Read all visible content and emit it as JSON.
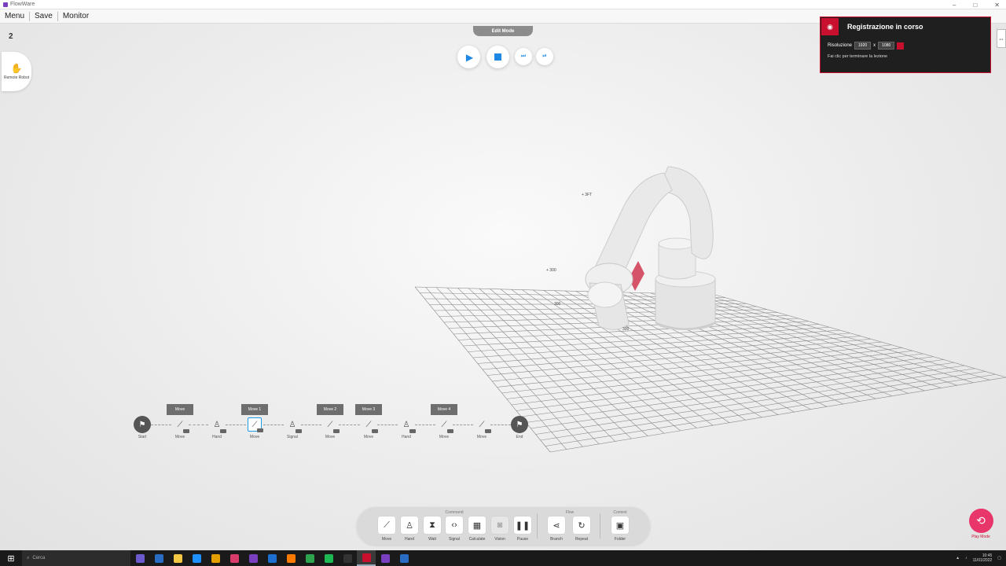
{
  "window": {
    "title": "FlowWare",
    "controls": [
      "–",
      "□",
      "✕"
    ]
  },
  "menubar": {
    "items": [
      "Menu",
      "Save",
      "Monitor"
    ]
  },
  "viewport": {
    "view_number": "2",
    "remote_button_label": "Remote Robot",
    "mode_tab": "Edit Mode"
  },
  "recording": {
    "title": "Registrazione in corso",
    "resolution_label": "Risoluzione",
    "width_value": "1920",
    "height_value": "1080",
    "note": "Fai clic per terminare la lezione"
  },
  "scene": {
    "labels": [
      "+ 3FT",
      "+ 300",
      "300",
      "300"
    ]
  },
  "flow": {
    "start_label": "Start",
    "end_label": "End",
    "nodes": [
      {
        "icon": "move",
        "label": "Move",
        "tag": "Move"
      },
      {
        "icon": "hand",
        "label": "Hand",
        "tag": ""
      },
      {
        "icon": "move",
        "label": "Move",
        "tag": "Move 1"
      },
      {
        "icon": "signal",
        "label": "Signal",
        "tag": ""
      },
      {
        "icon": "move",
        "label": "Move",
        "tag": "Move 2"
      },
      {
        "icon": "move",
        "label": "Move",
        "tag": "Move 3"
      },
      {
        "icon": "hand",
        "label": "Hand",
        "tag": ""
      },
      {
        "icon": "move",
        "label": "Move",
        "tag": "Move 4"
      },
      {
        "icon": "move",
        "label": "Move",
        "tag": ""
      }
    ]
  },
  "toolbar": {
    "groups": [
      "Command",
      "Flow",
      "Context"
    ],
    "buttons": [
      {
        "icon": "move-icon",
        "glyph": "⟋",
        "label": "Move",
        "disabled": false
      },
      {
        "icon": "hand-icon",
        "glyph": "♙",
        "label": "Hand",
        "disabled": false
      },
      {
        "icon": "wait-icon",
        "glyph": "⧗",
        "label": "Wait",
        "disabled": false
      },
      {
        "icon": "signal-icon",
        "glyph": "‹›",
        "label": "Signal",
        "disabled": false
      },
      {
        "icon": "calculate-icon",
        "glyph": "▦",
        "label": "Calculate",
        "disabled": false
      },
      {
        "icon": "vision-icon",
        "glyph": "◙",
        "label": "Vision",
        "disabled": true
      },
      {
        "icon": "pause-icon",
        "glyph": "❚❚",
        "label": "Pause",
        "disabled": false
      },
      {
        "icon": "branch-icon",
        "glyph": "⋖",
        "label": "Branch",
        "disabled": false
      },
      {
        "icon": "repeat-icon",
        "glyph": "↻",
        "label": "Repeat",
        "disabled": false
      },
      {
        "icon": "folder-icon",
        "glyph": "▣",
        "label": "Folder",
        "disabled": false
      }
    ]
  },
  "playmode": {
    "label": "Play Mode"
  },
  "taskbar": {
    "search_placeholder": "Cerca",
    "time": "10:45",
    "date": "11/01/2022"
  },
  "colors": {
    "accent": "#1e88e5",
    "record": "#c8102e",
    "playmode": "#e8356a"
  }
}
